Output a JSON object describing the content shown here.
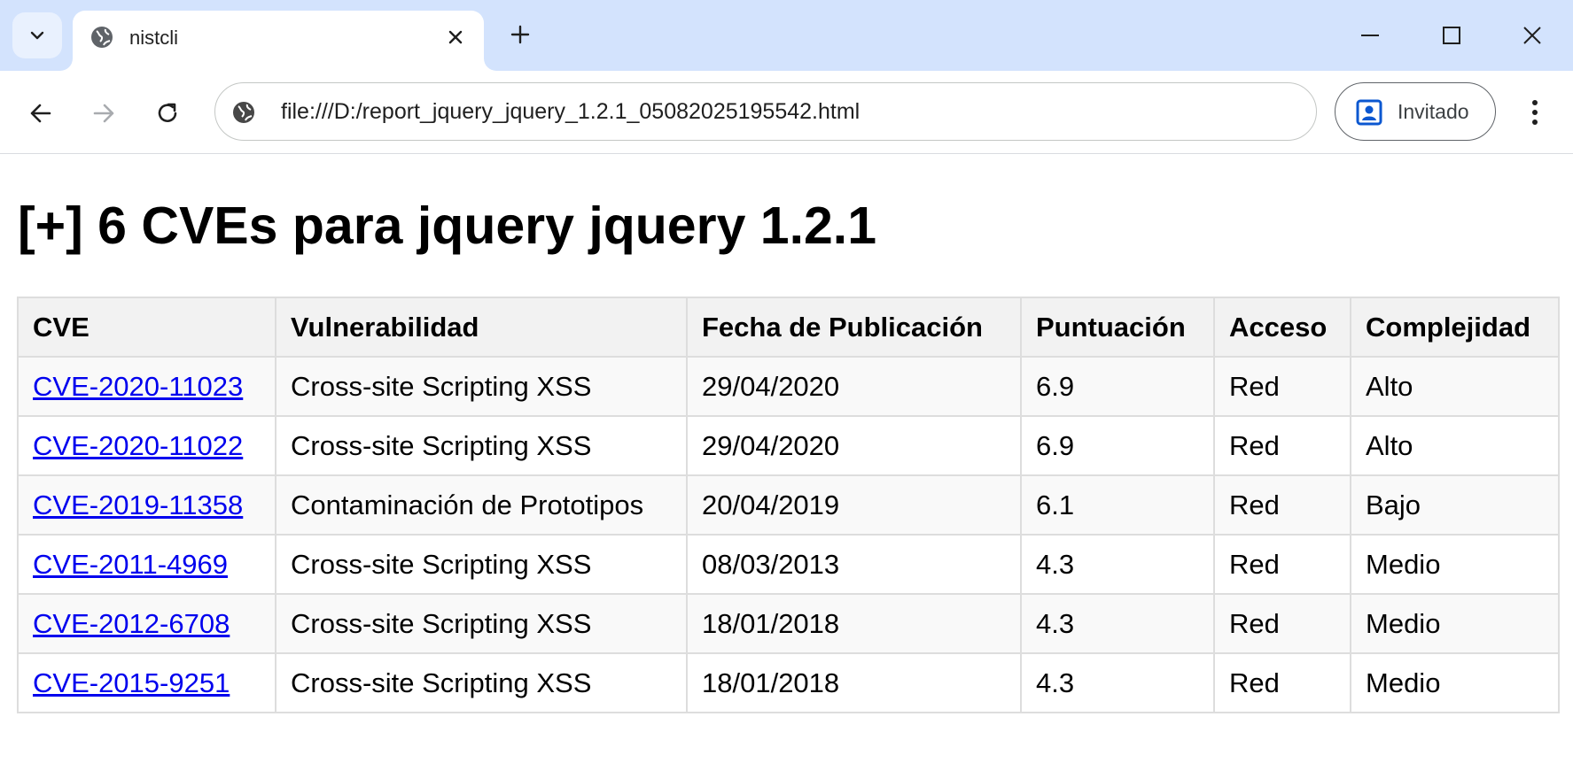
{
  "browser": {
    "tab": {
      "title": "nistcli"
    },
    "address": {
      "url": "file:///D:/report_jquery_jquery_1.2.1_05082025195542.html"
    },
    "profile": {
      "label": "Invitado"
    }
  },
  "page": {
    "heading": "[+] 6 CVEs para jquery jquery 1.2.1",
    "table": {
      "headers": [
        "CVE",
        "Vulnerabilidad",
        "Fecha de Publicación",
        "Puntuación",
        "Acceso",
        "Complejidad"
      ],
      "rows": [
        [
          "CVE-2020-11023",
          "Cross-site Scripting XSS",
          "29/04/2020",
          "6.9",
          "Red",
          "Alto"
        ],
        [
          "CVE-2020-11022",
          "Cross-site Scripting XSS",
          "29/04/2020",
          "6.9",
          "Red",
          "Alto"
        ],
        [
          "CVE-2019-11358",
          "Contaminación de Prototipos",
          "20/04/2019",
          "6.1",
          "Red",
          "Bajo"
        ],
        [
          "CVE-2011-4969",
          "Cross-site Scripting XSS",
          "08/03/2013",
          "4.3",
          "Red",
          "Medio"
        ],
        [
          "CVE-2012-6708",
          "Cross-site Scripting XSS",
          "18/01/2018",
          "4.3",
          "Red",
          "Medio"
        ],
        [
          "CVE-2015-9251",
          "Cross-site Scripting XSS",
          "18/01/2018",
          "4.3",
          "Red",
          "Medio"
        ]
      ]
    }
  },
  "icons": {
    "tab_search": "chevron-down-icon",
    "favicon": "globe-icon",
    "tab_close": "close-icon",
    "new_tab": "plus-icon",
    "minimize": "minimize-icon",
    "maximize": "maximize-icon",
    "window_close": "close-icon",
    "back": "arrow-left-icon",
    "forward": "arrow-right-icon",
    "reload": "reload-icon",
    "site_info": "globe-icon",
    "profile": "person-badge-icon",
    "menu": "kebab-menu-icon"
  },
  "colors": {
    "tabstrip": "#d3e3fd",
    "link": "#0000ee",
    "header_bg": "#f2f2f2",
    "row_alt": "#f9f9f9",
    "profile_accent": "#0b57d0"
  }
}
